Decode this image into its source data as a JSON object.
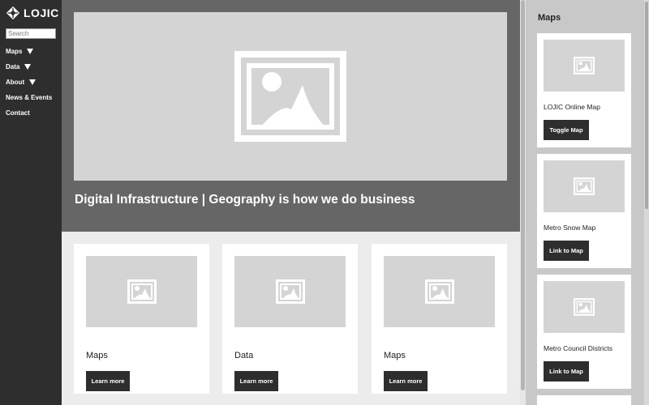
{
  "app": {
    "logo_text": "LOJIC",
    "logo_icon": "lojic-logo-icon"
  },
  "search": {
    "placeholder": "Search",
    "value": ""
  },
  "nav": {
    "items": [
      {
        "label": "Maps",
        "has_dropdown": true
      },
      {
        "label": "Data",
        "has_dropdown": true
      },
      {
        "label": "About",
        "has_dropdown": true
      },
      {
        "label": "News & Events",
        "has_dropdown": false
      },
      {
        "label": "Contact",
        "has_dropdown": false
      }
    ]
  },
  "hero": {
    "title": "Digital Infrastructure | Geography is how we do business",
    "image_icon": "image-placeholder-icon"
  },
  "cards": [
    {
      "title": "Maps",
      "button": "Learn more"
    },
    {
      "title": "Data",
      "button": "Learn more"
    },
    {
      "title": "Maps",
      "button": "Learn more"
    }
  ],
  "right_panel": {
    "title": "Maps",
    "items": [
      {
        "title": "LOJIC Online Map",
        "button": "Toggle Map"
      },
      {
        "title": "Metro Snow Map",
        "button": "Link to Map"
      },
      {
        "title": "Metro Council Districts",
        "button": "Link to Map"
      }
    ]
  },
  "colors": {
    "sidebar_bg": "#2e2e2e",
    "hero_bg": "#666666",
    "placeholder_bg": "#d4d4d4",
    "button_bg": "#2e2e2e",
    "page_bg": "#ececec",
    "right_panel_bg": "#c8c8c8"
  }
}
